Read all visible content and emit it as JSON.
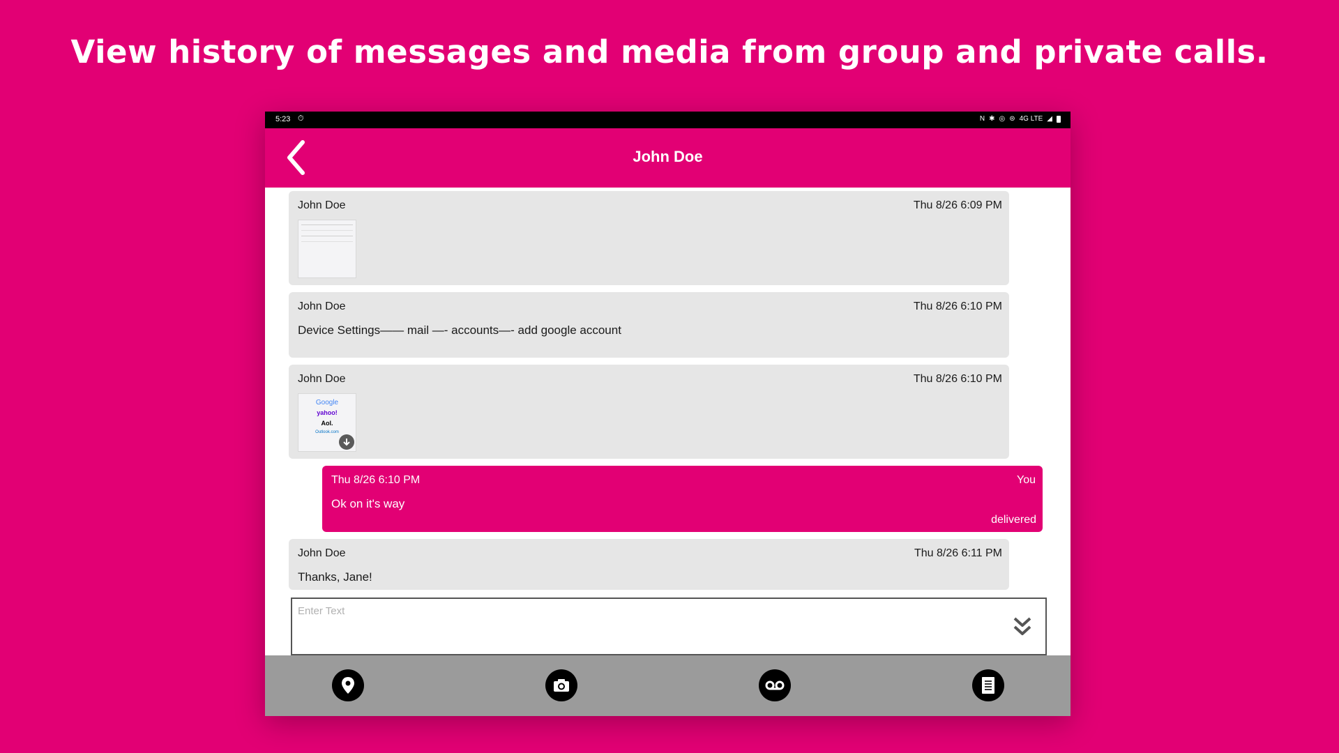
{
  "headline": "View history of messages and media from group and private calls.",
  "status_bar": {
    "time": "5:23",
    "network": "4G LTE"
  },
  "header": {
    "title": "John Doe"
  },
  "messages": [
    {
      "sender": "John Doe",
      "timestamp": "Thu 8/26 6:09 PM",
      "type": "image"
    },
    {
      "sender": "John Doe",
      "timestamp": "Thu 8/26 6:10 PM",
      "type": "text",
      "text": "Device Settings—— mail —- accounts—- add google account"
    },
    {
      "sender": "John Doe",
      "timestamp": "Thu 8/26 6:10 PM",
      "type": "image",
      "thumb_text": [
        "Google",
        "yahoo!",
        "Aol.",
        "Outlook.com"
      ]
    },
    {
      "sender": "You",
      "timestamp": "Thu 8/26 6:10 PM",
      "type": "text",
      "text": "Ok on it's way",
      "status": "delivered"
    },
    {
      "sender": "John Doe",
      "timestamp": "Thu 8/26 6:11 PM",
      "type": "text",
      "text": "Thanks, Jane!"
    }
  ],
  "composer": {
    "placeholder": "Enter Text"
  },
  "toolbar": {
    "icons": [
      "location-pin-icon",
      "camera-icon",
      "voicemail-icon",
      "document-icon"
    ]
  },
  "colors": {
    "brand": "#e20074",
    "incoming_bubble": "#e6e6e6",
    "toolbar": "#9b9b9b"
  }
}
